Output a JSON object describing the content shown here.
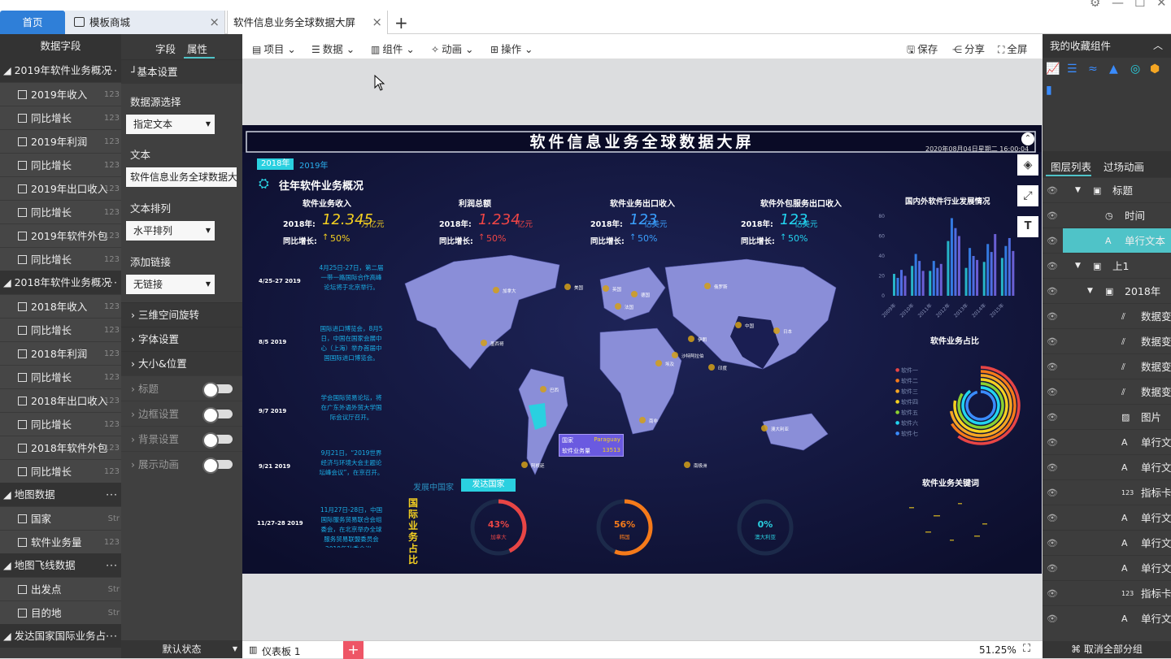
{
  "tabs": {
    "home": "首页",
    "template": "模板商城",
    "current": "软件信息业务全球数据大屏"
  },
  "left_panel": {
    "title": "数据字段",
    "groups": [
      {
        "name": "2019年软件业务概况",
        "items": [
          {
            "label": "2019年收入",
            "type": "123"
          },
          {
            "label": "同比增长",
            "type": "123"
          },
          {
            "label": "2019年利润",
            "type": "123"
          },
          {
            "label": "同比增长",
            "type": "123"
          },
          {
            "label": "2019年出口收入",
            "type": "123"
          },
          {
            "label": "同比增长",
            "type": "123"
          },
          {
            "label": "2019年软件外包",
            "type": "123"
          },
          {
            "label": "同比增长",
            "type": "123"
          }
        ]
      },
      {
        "name": "2018年软件业务概况",
        "items": [
          {
            "label": "2018年收入",
            "type": "123"
          },
          {
            "label": "同比增长",
            "type": "123"
          },
          {
            "label": "2018年利润",
            "type": "123"
          },
          {
            "label": "同比增长",
            "type": "123"
          },
          {
            "label": "2018年出口收入",
            "type": "123"
          },
          {
            "label": "同比增长",
            "type": "123"
          },
          {
            "label": "2018年软件外包",
            "type": "123"
          },
          {
            "label": "同比增长",
            "type": "123"
          }
        ]
      },
      {
        "name": "地图数据",
        "items": [
          {
            "label": "国家",
            "type": "Str"
          },
          {
            "label": "软件业务量",
            "type": "123"
          }
        ]
      },
      {
        "name": "地图飞线数据",
        "items": [
          {
            "label": "出发点",
            "type": "Str"
          },
          {
            "label": "目的地",
            "type": "Str"
          }
        ]
      },
      {
        "name": "发达国家国际业务占",
        "items": []
      }
    ]
  },
  "property_panel": {
    "tab_field": "字段",
    "tab_property": "属性",
    "basic": "基本设置",
    "datasource_label": "数据源选择",
    "datasource_value": "指定文本",
    "text_label": "文本",
    "text_value": "软件信息业务全球数据大",
    "arrange_label": "文本排列",
    "arrange_value": "水平排列",
    "link_label": "添加链接",
    "link_value": "无链接",
    "sections": [
      "三维空间旋转",
      "字体设置",
      "大小&位置"
    ],
    "toggles": [
      "标题",
      "边框设置",
      "背景设置",
      "展示动画"
    ],
    "footer": "默认状态"
  },
  "toolbar": {
    "project": "项目",
    "data": "数据",
    "component": "组件",
    "animation": "动画",
    "operate": "操作",
    "save": "保存",
    "share": "分享",
    "fullscreen": "全屏"
  },
  "dashboard": {
    "title": "软件信息业务全球数据大屏",
    "datetime": "2020年08月04日星期二 16:00:04",
    "year_tabs": [
      "2018年",
      "2019年"
    ],
    "section_title": "往年软件业务概况",
    "kpis": [
      {
        "title": "软件业务收入",
        "year": "2018年:",
        "value": "12.345",
        "unit": "万亿元",
        "growth_label": "同比增长:",
        "growth": "50%",
        "color": "#f5d020"
      },
      {
        "title": "利润总额",
        "year": "2018年:",
        "value": "1.234",
        "unit": "亿元",
        "growth_label": "同比增长:",
        "growth": "50%",
        "color": "#f04545"
      },
      {
        "title": "软件业务出口收入",
        "year": "2018年:",
        "value": "123",
        "unit": "亿美元",
        "growth_label": "同比增长:",
        "growth": "50%",
        "color": "#3aa0ff"
      },
      {
        "title": "软件外包服务出口收入",
        "year": "2018年:",
        "value": "123",
        "unit": "亿美元",
        "growth_label": "同比增长:",
        "growth": "50%",
        "color": "#22d4f0"
      }
    ],
    "timeline": [
      {
        "date": "4/25-27 2019",
        "text": "4月25日-27日，第二届一带一路国际合作高峰论坛将于北京举行。"
      },
      {
        "date": "8/5 2019",
        "text": "国际进口博览会，8月5日，中国在国家会展中心（上海）举办首届中国国际进口博览会。"
      },
      {
        "date": "9/7 2019",
        "text": "学会国际贸易论坛，将在广东外语外贸大学国际会议厅召开。"
      },
      {
        "date": "9/21 2019",
        "text": "9月21日，“2019世界经济与环境大会主题论坛峰会议”，在京召开。"
      },
      {
        "date": "11/27-28 2019",
        "text": "11月27日-28日，中国国际服务贸易联合会组委会，在北京举办全球服务贸易联盟委员会2019年秋季会议。"
      }
    ],
    "map_tooltip": {
      "country_label": "国家",
      "country": "Paraguay",
      "metric_label": "软件业务量",
      "metric": "13513"
    },
    "map_labels": [
      "加拿大",
      "美国",
      "墨西哥",
      "巴西",
      "阿根廷",
      "中国",
      "俄罗斯",
      "日本",
      "印度",
      "澳大利亚",
      "南非",
      "埃及",
      "法国",
      "德国",
      "英国",
      "沙特阿拉伯",
      "伊朗",
      "南极洲"
    ],
    "dev_tabs": [
      "发展中国家",
      "发达国家"
    ],
    "intl_title": "国际业务占比",
    "gauges": [
      {
        "value": 43,
        "label": "43%",
        "name": "加拿大",
        "color": "#e84545"
      },
      {
        "value": 56,
        "label": "56%",
        "name": "韩国",
        "color": "#f57a1a"
      },
      {
        "value": 0,
        "label": "0%",
        "name": "澳大利亚",
        "color": "#2ad0e0"
      }
    ],
    "right_title1": "国内外软件行业发展情况",
    "share_title": "软件业务占比",
    "share_legend": [
      "软件一",
      "软件二",
      "软件三",
      "软件四",
      "软件五",
      "软件六",
      "软件七"
    ],
    "share_colors": [
      "#e84545",
      "#f57a1a",
      "#f5a623",
      "#f5d020",
      "#8bd130",
      "#22d4f0",
      "#3a8cff"
    ],
    "keyword_title": "软件业务关键词"
  },
  "chart_data": {
    "type": "bar",
    "title": "国内外软件行业发展情况",
    "categories": [
      "2009年",
      "2010年",
      "2011年",
      "2012年",
      "2013年",
      "2014年",
      "2015年"
    ],
    "ylim": [
      0,
      80
    ],
    "yticks": [
      "0",
      "20",
      "40",
      "60",
      "80"
    ],
    "series": [
      {
        "values": [
          22,
          30,
          25,
          55,
          28,
          34,
          38
        ]
      },
      {
        "values": [
          18,
          42,
          35,
          78,
          48,
          52,
          50
        ]
      },
      {
        "values": [
          26,
          35,
          28,
          68,
          40,
          44,
          58
        ]
      },
      {
        "values": [
          20,
          25,
          32,
          60,
          36,
          62,
          45
        ]
      }
    ]
  },
  "right_panel": {
    "title": "我的收藏组件",
    "tab_layers": "图层列表",
    "tab_transition": "过场动画",
    "layers": [
      {
        "label": "标题",
        "indent": 1,
        "icon": "▣",
        "expand": true
      },
      {
        "label": "时间",
        "indent": 2,
        "icon": "◷",
        "expand": false
      },
      {
        "label": "单行文本",
        "indent": 2,
        "icon": "A",
        "expand": false,
        "selected": true
      },
      {
        "label": "上1",
        "indent": 1,
        "icon": "▣",
        "expand": true
      },
      {
        "label": "2018年",
        "indent": 2,
        "icon": "▣",
        "expand": true
      },
      {
        "label": "数据变化",
        "indent": 3,
        "icon": "⫽",
        "expand": false
      },
      {
        "label": "数据变化",
        "indent": 3,
        "icon": "⫽",
        "expand": false
      },
      {
        "label": "数据变化",
        "indent": 3,
        "icon": "⫽",
        "expand": false
      },
      {
        "label": "数据变化",
        "indent": 3,
        "icon": "⫽",
        "expand": false
      },
      {
        "label": "图片",
        "indent": 3,
        "icon": "▨",
        "expand": false
      },
      {
        "label": "单行文本",
        "indent": 3,
        "icon": "A",
        "expand": false
      },
      {
        "label": "单行文本",
        "indent": 3,
        "icon": "A",
        "expand": false
      },
      {
        "label": "指标卡",
        "indent": 3,
        "icon": "123",
        "expand": false
      },
      {
        "label": "单行文本",
        "indent": 3,
        "icon": "A",
        "expand": false
      },
      {
        "label": "单行文本",
        "indent": 3,
        "icon": "A",
        "expand": false
      },
      {
        "label": "单行文本",
        "indent": 3,
        "icon": "A",
        "expand": false
      },
      {
        "label": "指标卡",
        "indent": 3,
        "icon": "123",
        "expand": false
      },
      {
        "label": "单行文本",
        "indent": 3,
        "icon": "A",
        "expand": false
      }
    ],
    "footer": "取消全部分组"
  },
  "bottom": {
    "page_name": "仪表板 1",
    "zoom": "51.25%"
  }
}
